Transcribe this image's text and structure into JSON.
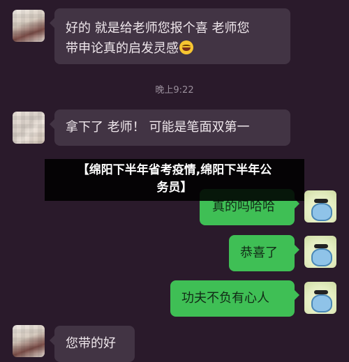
{
  "chat": {
    "timestamp": "晚上9:22",
    "messages": [
      {
        "side": "left",
        "lines": [
          "好的 就是给老师您报个喜 老师您",
          "带申论真的启发灵感"
        ],
        "emoji": "grinning-face-emoji"
      },
      {
        "side": "left",
        "lines": [
          "拿下了 老师！ 可能是笔面双第一"
        ]
      },
      {
        "side": "right",
        "lines": [
          "真的吗哈哈"
        ]
      },
      {
        "side": "right",
        "lines": [
          "恭喜了"
        ]
      },
      {
        "side": "right",
        "lines": [
          "功夫不负有心人"
        ]
      },
      {
        "side": "left",
        "lines": [
          "您带的好"
        ]
      }
    ]
  },
  "overlay": {
    "title_line1": "【绵阳下半年省考疫情,绵阳下半年公",
    "title_line2": "务员】"
  },
  "colors": {
    "background": "#2a1a2b",
    "incoming_bubble": "#423444",
    "outgoing_bubble": "#3fbf55"
  }
}
